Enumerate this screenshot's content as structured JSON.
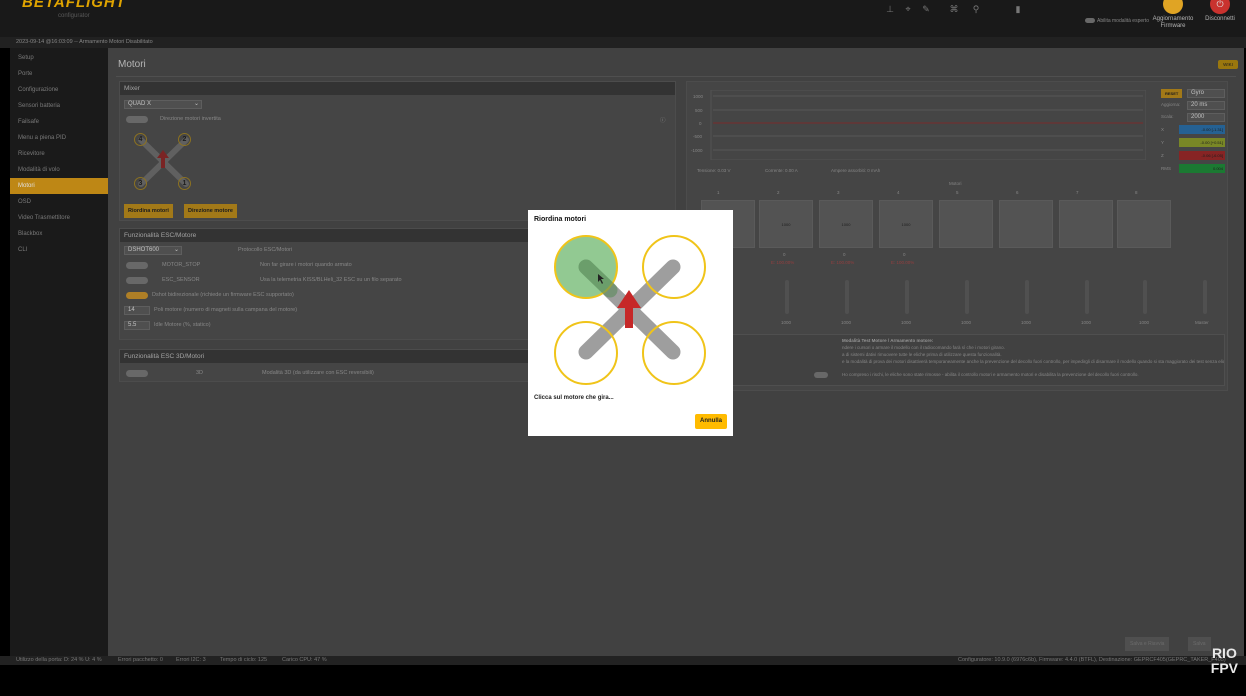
{
  "header": {
    "logo": "BETAFLIGHT",
    "logo_sub": "configurator",
    "expert_mode": "Abilita modalità esperto",
    "update_firmware": "Aggiornamento Firmware",
    "disconnect": "Disconnetti"
  },
  "statusline": "2023-09-14 @16:03:09 -- Armamento Motori Disabilitato",
  "sidebar": {
    "items": [
      {
        "label": "Setup"
      },
      {
        "label": "Porte"
      },
      {
        "label": "Configurazione"
      },
      {
        "label": "Sensori batteria"
      },
      {
        "label": "Failsafe"
      },
      {
        "label": "Menu a piena PID"
      },
      {
        "label": "Ricevitore"
      },
      {
        "label": "Modalità di volo"
      },
      {
        "label": "Motori"
      },
      {
        "label": "OSD"
      },
      {
        "label": "Video Trasmettitore"
      },
      {
        "label": "Blackbox"
      },
      {
        "label": "CLI"
      }
    ]
  },
  "main": {
    "title": "Motori",
    "wiki": "WIKI",
    "mixer": {
      "header": "Mixer",
      "mixer_type": "QUAD X",
      "reverse_label": "Direzione motori invertita",
      "btn_reorder": "Riordina motori",
      "btn_direction": "Direzione motore",
      "motor_numbers": [
        "4",
        "2",
        "3",
        "1"
      ]
    },
    "esc": {
      "header": "Funzionalità ESC/Motore",
      "protocol": "DSHOT600",
      "protocol_label": "Protocollo ESC/Motori",
      "motor_stop": "MOTOR_STOP",
      "motor_stop_desc": "Non far girare i motori quando armato",
      "esc_sensor": "ESC_SENSOR",
      "esc_sensor_desc": "Usa la telemetria KISS/BLHeli_32 ESC su un filo separato",
      "bidir": "Dshot bidirezionale (richiede un firmware ESC supportato)",
      "poles_value": "14",
      "poles_label": "Poli motore (numero di magneti sulla campana del motore)",
      "idle_value": "5.5",
      "idle_label": "Idle Motore (%, statico)"
    },
    "esc3d": {
      "header": "Funzionalità ESC 3D/Motori",
      "label": "3D",
      "desc": "Modalità 3D (da utilizzare con ESC reversibili)"
    },
    "sensor": {
      "reset": "RESET",
      "sensor_select": "Gyro",
      "refresh_label": "Aggiorna:",
      "refresh": "20 ms",
      "scale_label": "Scala:",
      "scale": "2000",
      "axes": [
        {
          "label": "X",
          "value": "-0.00 [-1.31]",
          "color": "#2196f3"
        },
        {
          "label": "Y",
          "value": "-0.00 [+0.51]",
          "color": "#cddc39"
        },
        {
          "label": "Z",
          "value": "-0.06 [-6.05]",
          "color": "#e53935"
        },
        {
          "label": "RMS",
          "value": "0.004",
          "color": "#00c853"
        }
      ],
      "y_ticks": [
        "1000",
        "500",
        "0",
        "-500",
        "-1000"
      ],
      "voltage": "Tensione:",
      "voltage_val": "0.03 V",
      "current": "Corrente:",
      "current_val": "0.00 A",
      "mah": "Ampere assorbiti:",
      "mah_val": "0 mAh"
    },
    "motors": {
      "label": "Motori",
      "numbers": [
        "1",
        "2",
        "3",
        "4",
        "5",
        "6",
        "7",
        "8"
      ],
      "slot_value": "1000",
      "rpm": "0",
      "error": "E: 100.00%",
      "slider_value": "1000",
      "master": "Master"
    },
    "warning": {
      "title": "Modalità Test Motore / Armamento motore:",
      "line1": "ndere i cursori o armare il modello con il radiocomando farà sì che i motori girano.",
      "line2": "a di sistemi dativi rimuovere tutte le eliche prima di utilizzare questa funzionalità.",
      "line3": "e la modalità di prova dei motori disattiverà temporaneamente anche la prevenzione del decollo fuori controllo, per impedirgli di disarmare il modello quando si sta maggiorato dei test senza eliche.",
      "line4": "Ho compreso i rischi, le eliche sono state rimosse - abilita il controllo motori e armamento motori e disabilita la prevenzione del decollo fuori controllo."
    },
    "bottom_buttons": [
      "Salva e Riavvia",
      "Salva"
    ]
  },
  "dialog": {
    "title": "Riordina motori",
    "instruction": "Clicca sul motore che gira...",
    "cancel": "Annulla",
    "highlight_color": "#7fbf7f",
    "ring_color": "#f0c419",
    "arrow_color": "#c62828"
  },
  "footer": {
    "port_usage": "Utilizzo della porta: D: 24 % U: 4 %",
    "packet_errors": "Errori pacchetto: 0",
    "i2c_errors": "Errori I2C: 3",
    "cycle_time": "Tempo di ciclo: 125",
    "cpu_load": "Carico CPU: 47 %",
    "config": "Configuratore: 10.9.0 (6976c6b), Firmware: 4.4.0 (BTFL), Destinazione: GEPRCF405(GEPRC_TAKER_F405)"
  },
  "watermark": {
    "line1": "RIO",
    "line2": "FPV"
  }
}
